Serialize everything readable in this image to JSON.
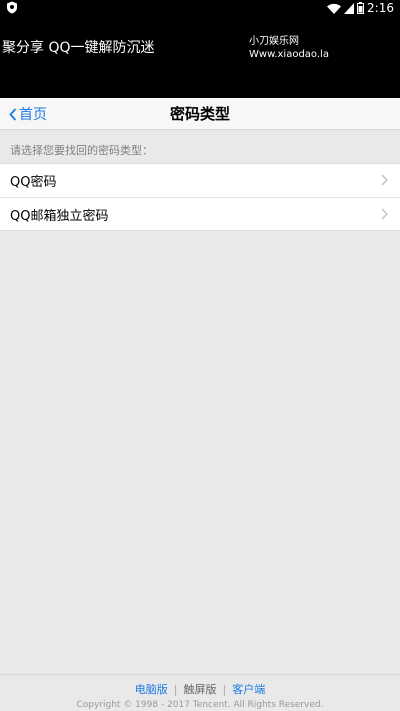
{
  "status_bar": {
    "time": "2:16",
    "icons": [
      "shield-icon",
      "wifi-icon",
      "signal-icon",
      "battery-icon"
    ]
  },
  "banner": {
    "left_text": "聚分享 QQ一键解防沉迷",
    "right_title": "小刀娱乐网",
    "right_url": "Www.xiaodao.la"
  },
  "navbar": {
    "back_label": "首页",
    "title": "密码类型"
  },
  "main": {
    "hint": "请选择您要找回的密码类型：",
    "items": [
      {
        "label": "QQ密码"
      },
      {
        "label": "QQ邮箱独立密码"
      }
    ]
  },
  "footer": {
    "links": [
      "电脑版",
      "触屏版",
      "客户端"
    ],
    "separator": "|",
    "copyright": "Copyright © 1998 - 2017 Tencent. All Rights Reserved."
  },
  "colors": {
    "accent": "#1f7be2",
    "background": "#e9e9e9",
    "status_bar": "#000000"
  }
}
